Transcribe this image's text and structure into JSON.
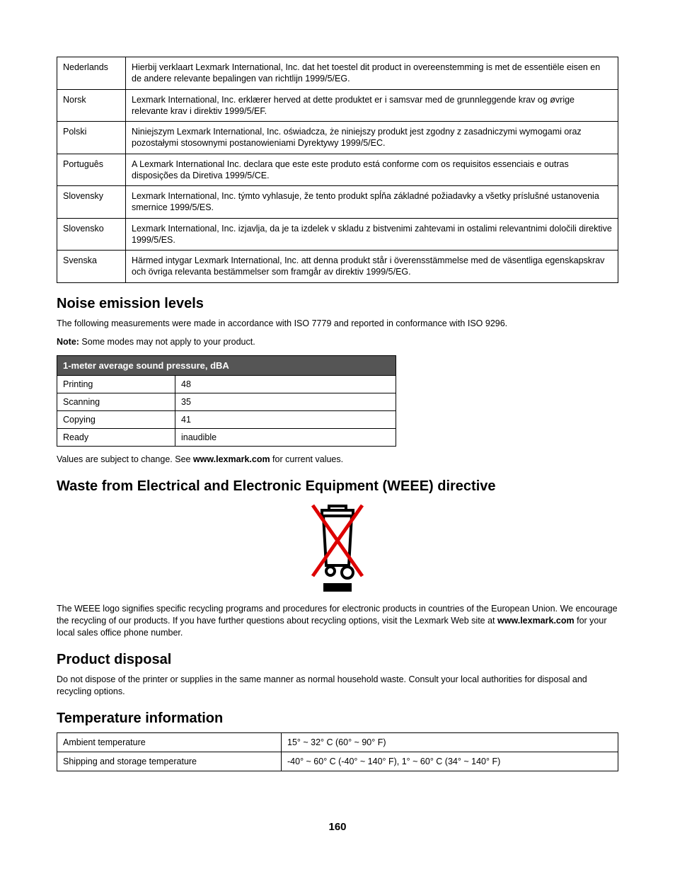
{
  "langTable": [
    {
      "lang": "Nederlands",
      "text": "Hierbij verklaart Lexmark International, Inc. dat het toestel dit product in overeenstemming is met de essentiële eisen en de andere relevante bepalingen van richtlijn 1999/5/EG."
    },
    {
      "lang": "Norsk",
      "text": "Lexmark International, Inc. erklærer herved at dette produktet er i samsvar med de grunnleggende krav og øvrige relevante krav i direktiv 1999/5/EF."
    },
    {
      "lang": "Polski",
      "text": "Niniejszym Lexmark International, Inc. oświadcza, że niniejszy produkt jest zgodny z zasadniczymi wymogami oraz pozostałymi stosownymi postanowieniami Dyrektywy 1999/5/EC."
    },
    {
      "lang": "Português",
      "text": "A Lexmark International Inc. declara que este este produto está conforme com os requisitos essenciais e outras disposições da Diretiva 1999/5/CE."
    },
    {
      "lang": "Slovensky",
      "text": "Lexmark International, Inc. týmto vyhlasuje, že tento produkt spĺňa základné požiadavky a všetky príslušné ustanovenia smernice 1999/5/ES."
    },
    {
      "lang": "Slovensko",
      "text": "Lexmark International, Inc. izjavlja, da je ta izdelek v skladu z bistvenimi zahtevami in ostalimi relevantnimi določili direktive 1999/5/ES."
    },
    {
      "lang": "Svenska",
      "text": "Härmed intygar Lexmark International, Inc. att denna produkt står i överensstämmelse med de väsentliga egenskapskrav och övriga relevanta bestämmelser som framgår av direktiv 1999/5/EG."
    }
  ],
  "noise": {
    "heading": "Noise emission levels",
    "intro": "The following measurements were made in accordance with ISO 7779 and reported in conformance with ISO 9296.",
    "noteLabel": "Note:",
    "noteText": " Some modes may not apply to your product.",
    "colHeader": "1-meter average sound pressure, dBA",
    "rows": [
      {
        "mode": "Printing",
        "val": "48"
      },
      {
        "mode": "Scanning",
        "val": "35"
      },
      {
        "mode": "Copying",
        "val": "41"
      },
      {
        "mode": "Ready",
        "val": "inaudible"
      }
    ],
    "footPre": "Values are subject to change. See ",
    "footBold": "www.lexmark.com",
    "footPost": " for current values."
  },
  "weee": {
    "heading": "Waste from Electrical and Electronic Equipment (WEEE) directive",
    "textPre": "The WEEE logo signifies specific recycling programs and procedures for electronic products in countries of the European Union. We encourage the recycling of our products. If you have further questions about recycling options, visit the Lexmark Web site at ",
    "textBold": "www.lexmark.com",
    "textPost": " for your local sales office phone number."
  },
  "disposal": {
    "heading": "Product disposal",
    "text": "Do not dispose of the printer or supplies in the same manner as normal household waste. Consult your local authorities for disposal and recycling options."
  },
  "temp": {
    "heading": "Temperature information",
    "rows": [
      {
        "label": "Ambient temperature",
        "val": "15° ~ 32° C (60° ~ 90° F)"
      },
      {
        "label": "Shipping and storage temperature",
        "val": "-40° ~ 60° C (-40° ~ 140° F), 1° ~ 60° C (34° ~ 140° F)"
      }
    ]
  },
  "pageNum": "160"
}
